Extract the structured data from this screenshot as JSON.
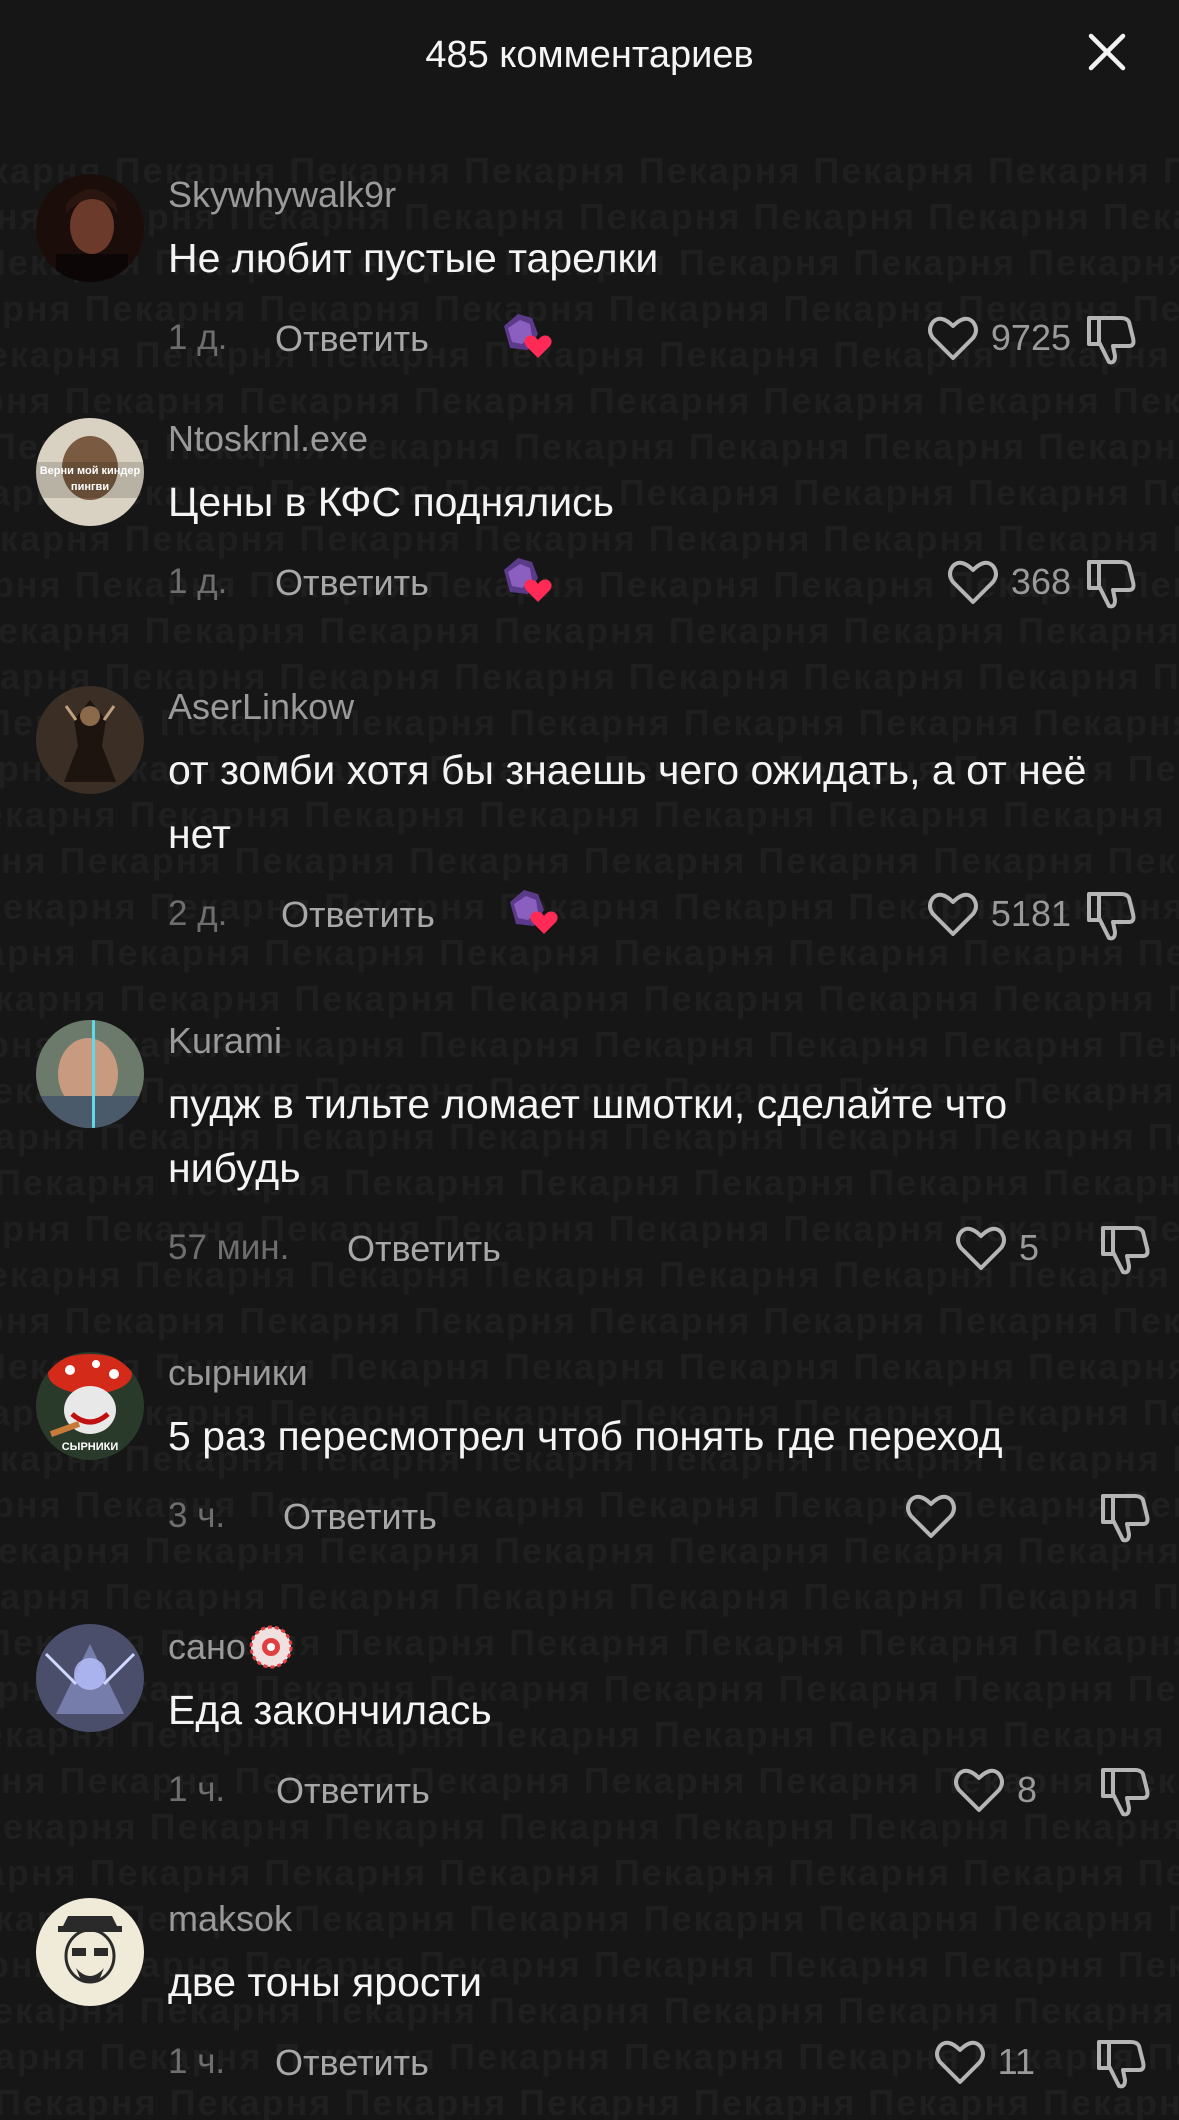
{
  "header": {
    "title": "485 комментариев"
  },
  "watermark": {
    "word": "Пекарня"
  },
  "colors": {
    "background": "#161616",
    "like_heart_badge": "#ff2a55",
    "creator_badge": "#6a3fa0"
  },
  "comments": [
    {
      "username": "Skywhywalk9r",
      "text": "Не любит пустые тарелки",
      "time": "1 д.",
      "reply_label": "Ответить",
      "likes": "9725",
      "creator_liked": true
    },
    {
      "username": "Ntoskrnl.exe",
      "avatar_text": "Верни мой киндер пингви",
      "text": "Цены в КФС поднялись",
      "time": "1 д.",
      "reply_label": "Ответить",
      "likes": "368",
      "creator_liked": true
    },
    {
      "username": "AserLinkow",
      "text": "от зомби хотя бы знаешь чего ожидать, а от неё нет",
      "time": "2 д.",
      "reply_label": "Ответить",
      "likes": "5181",
      "creator_liked": true
    },
    {
      "username": "Kurami",
      "text": "пудж в тильте ломает шмотки, сделайте что нибудь",
      "time": "57 мин.",
      "reply_label": "Ответить",
      "likes": "5",
      "creator_liked": false
    },
    {
      "username": "сырники",
      "avatar_text": "СЫРНИКИ",
      "text": "5 раз пересмотрел чтоб понять где переход",
      "time": "3 ч.",
      "reply_label": "Ответить",
      "likes": "",
      "creator_liked": false
    },
    {
      "username": "сано",
      "text": "Еда закончилась",
      "time": "1 ч.",
      "reply_label": "Ответить",
      "likes": "8",
      "creator_liked": false
    },
    {
      "username": "maksok",
      "text": "две тоны ярости",
      "time": "1 ч.",
      "reply_label": "Ответить",
      "likes": "11",
      "creator_liked": false
    }
  ]
}
